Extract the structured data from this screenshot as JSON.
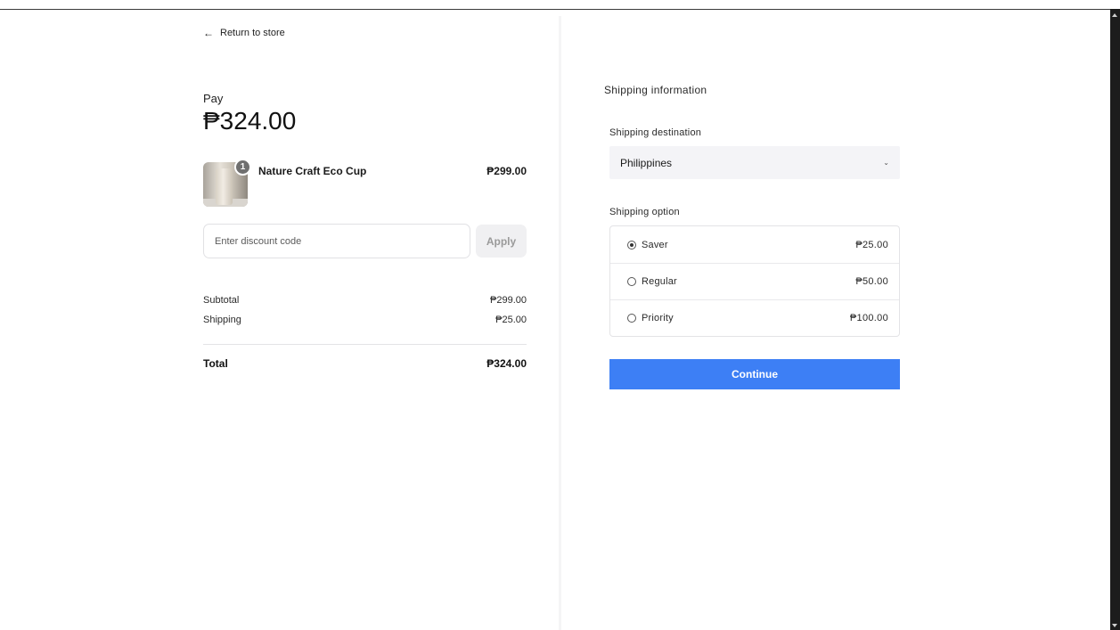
{
  "back_link": {
    "label": "Return to store",
    "icon": "arrow-left-icon"
  },
  "summary": {
    "pay_label": "Pay",
    "pay_amount": "₱324.00",
    "item": {
      "name": "Nature Craft Eco Cup",
      "price": "₱299.00",
      "quantity": "1"
    },
    "discount": {
      "placeholder": "Enter discount code",
      "value": "",
      "apply_label": "Apply"
    },
    "subtotal": {
      "label": "Subtotal",
      "value": "₱299.00"
    },
    "shipping": {
      "label": "Shipping",
      "value": "₱25.00"
    },
    "total": {
      "label": "Total",
      "value": "₱324.00"
    }
  },
  "shipping_info": {
    "title": "Shipping information",
    "destination_label": "Shipping destination",
    "destination_value": "Philippines",
    "option_label": "Shipping option",
    "options": [
      {
        "label": "Saver",
        "price": "₱25.00",
        "selected": true
      },
      {
        "label": "Regular",
        "price": "₱50.00",
        "selected": false
      },
      {
        "label": "Priority",
        "price": "₱100.00",
        "selected": false
      }
    ],
    "continue_label": "Continue"
  },
  "colors": {
    "accent": "#3d7ff5",
    "input_bg": "#f4f4f7",
    "border": "#e3e3e6"
  }
}
